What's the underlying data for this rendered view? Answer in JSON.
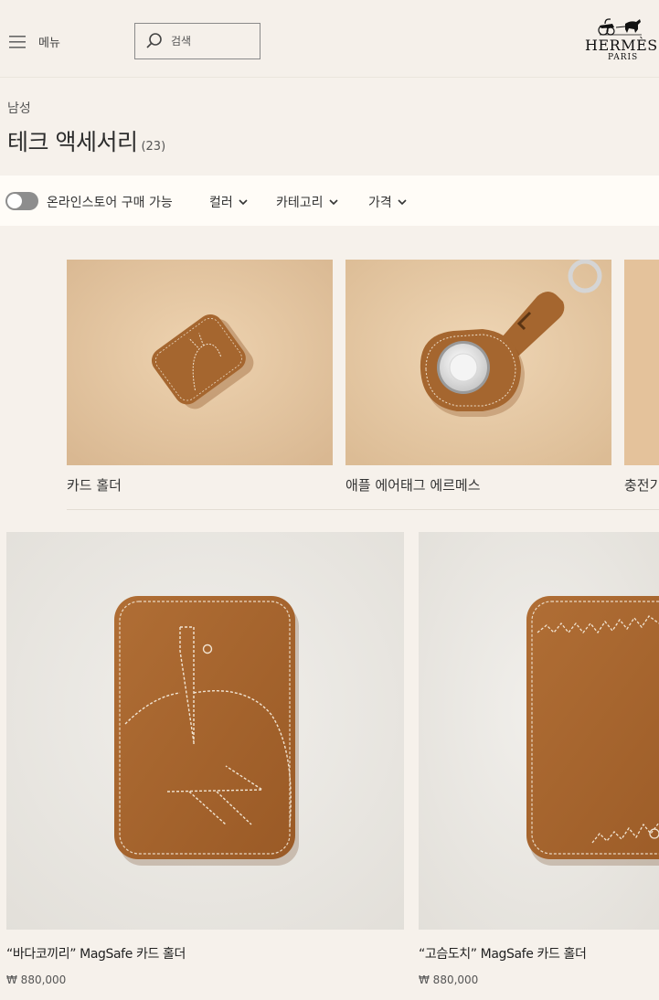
{
  "header": {
    "menu_label": "메뉴",
    "search_placeholder": "검색",
    "logo_word": "HERMÈS",
    "logo_sub": "PARIS"
  },
  "breadcrumb": "남성",
  "page": {
    "title": "테크 액세서리",
    "count": "(23)"
  },
  "filters": {
    "toggle_label": "온라인스토어 구매 가능",
    "toggle_on": false,
    "color": "컬러",
    "category": "카테고리",
    "price": "가격"
  },
  "categories": [
    {
      "label": "카드 홀더"
    },
    {
      "label": "애플 에어태그 에르메스"
    },
    {
      "label": "충전기"
    }
  ],
  "products": [
    {
      "name": "“바다코끼리” MagSafe 카드 홀더",
      "price": "₩ 880,000"
    },
    {
      "name": "“고슴도치” MagSafe 카드 홀더",
      "price": "₩ 880,000"
    }
  ],
  "colors": {
    "leather": "#a5662f",
    "beige_bg": "#e3c49f",
    "product_bg": "#ebe8e3",
    "page_bg": "#f6f1eb"
  },
  "icons": {
    "menu": "hamburger-icon",
    "search": "search-icon",
    "chevron": "chevron-down-icon"
  }
}
